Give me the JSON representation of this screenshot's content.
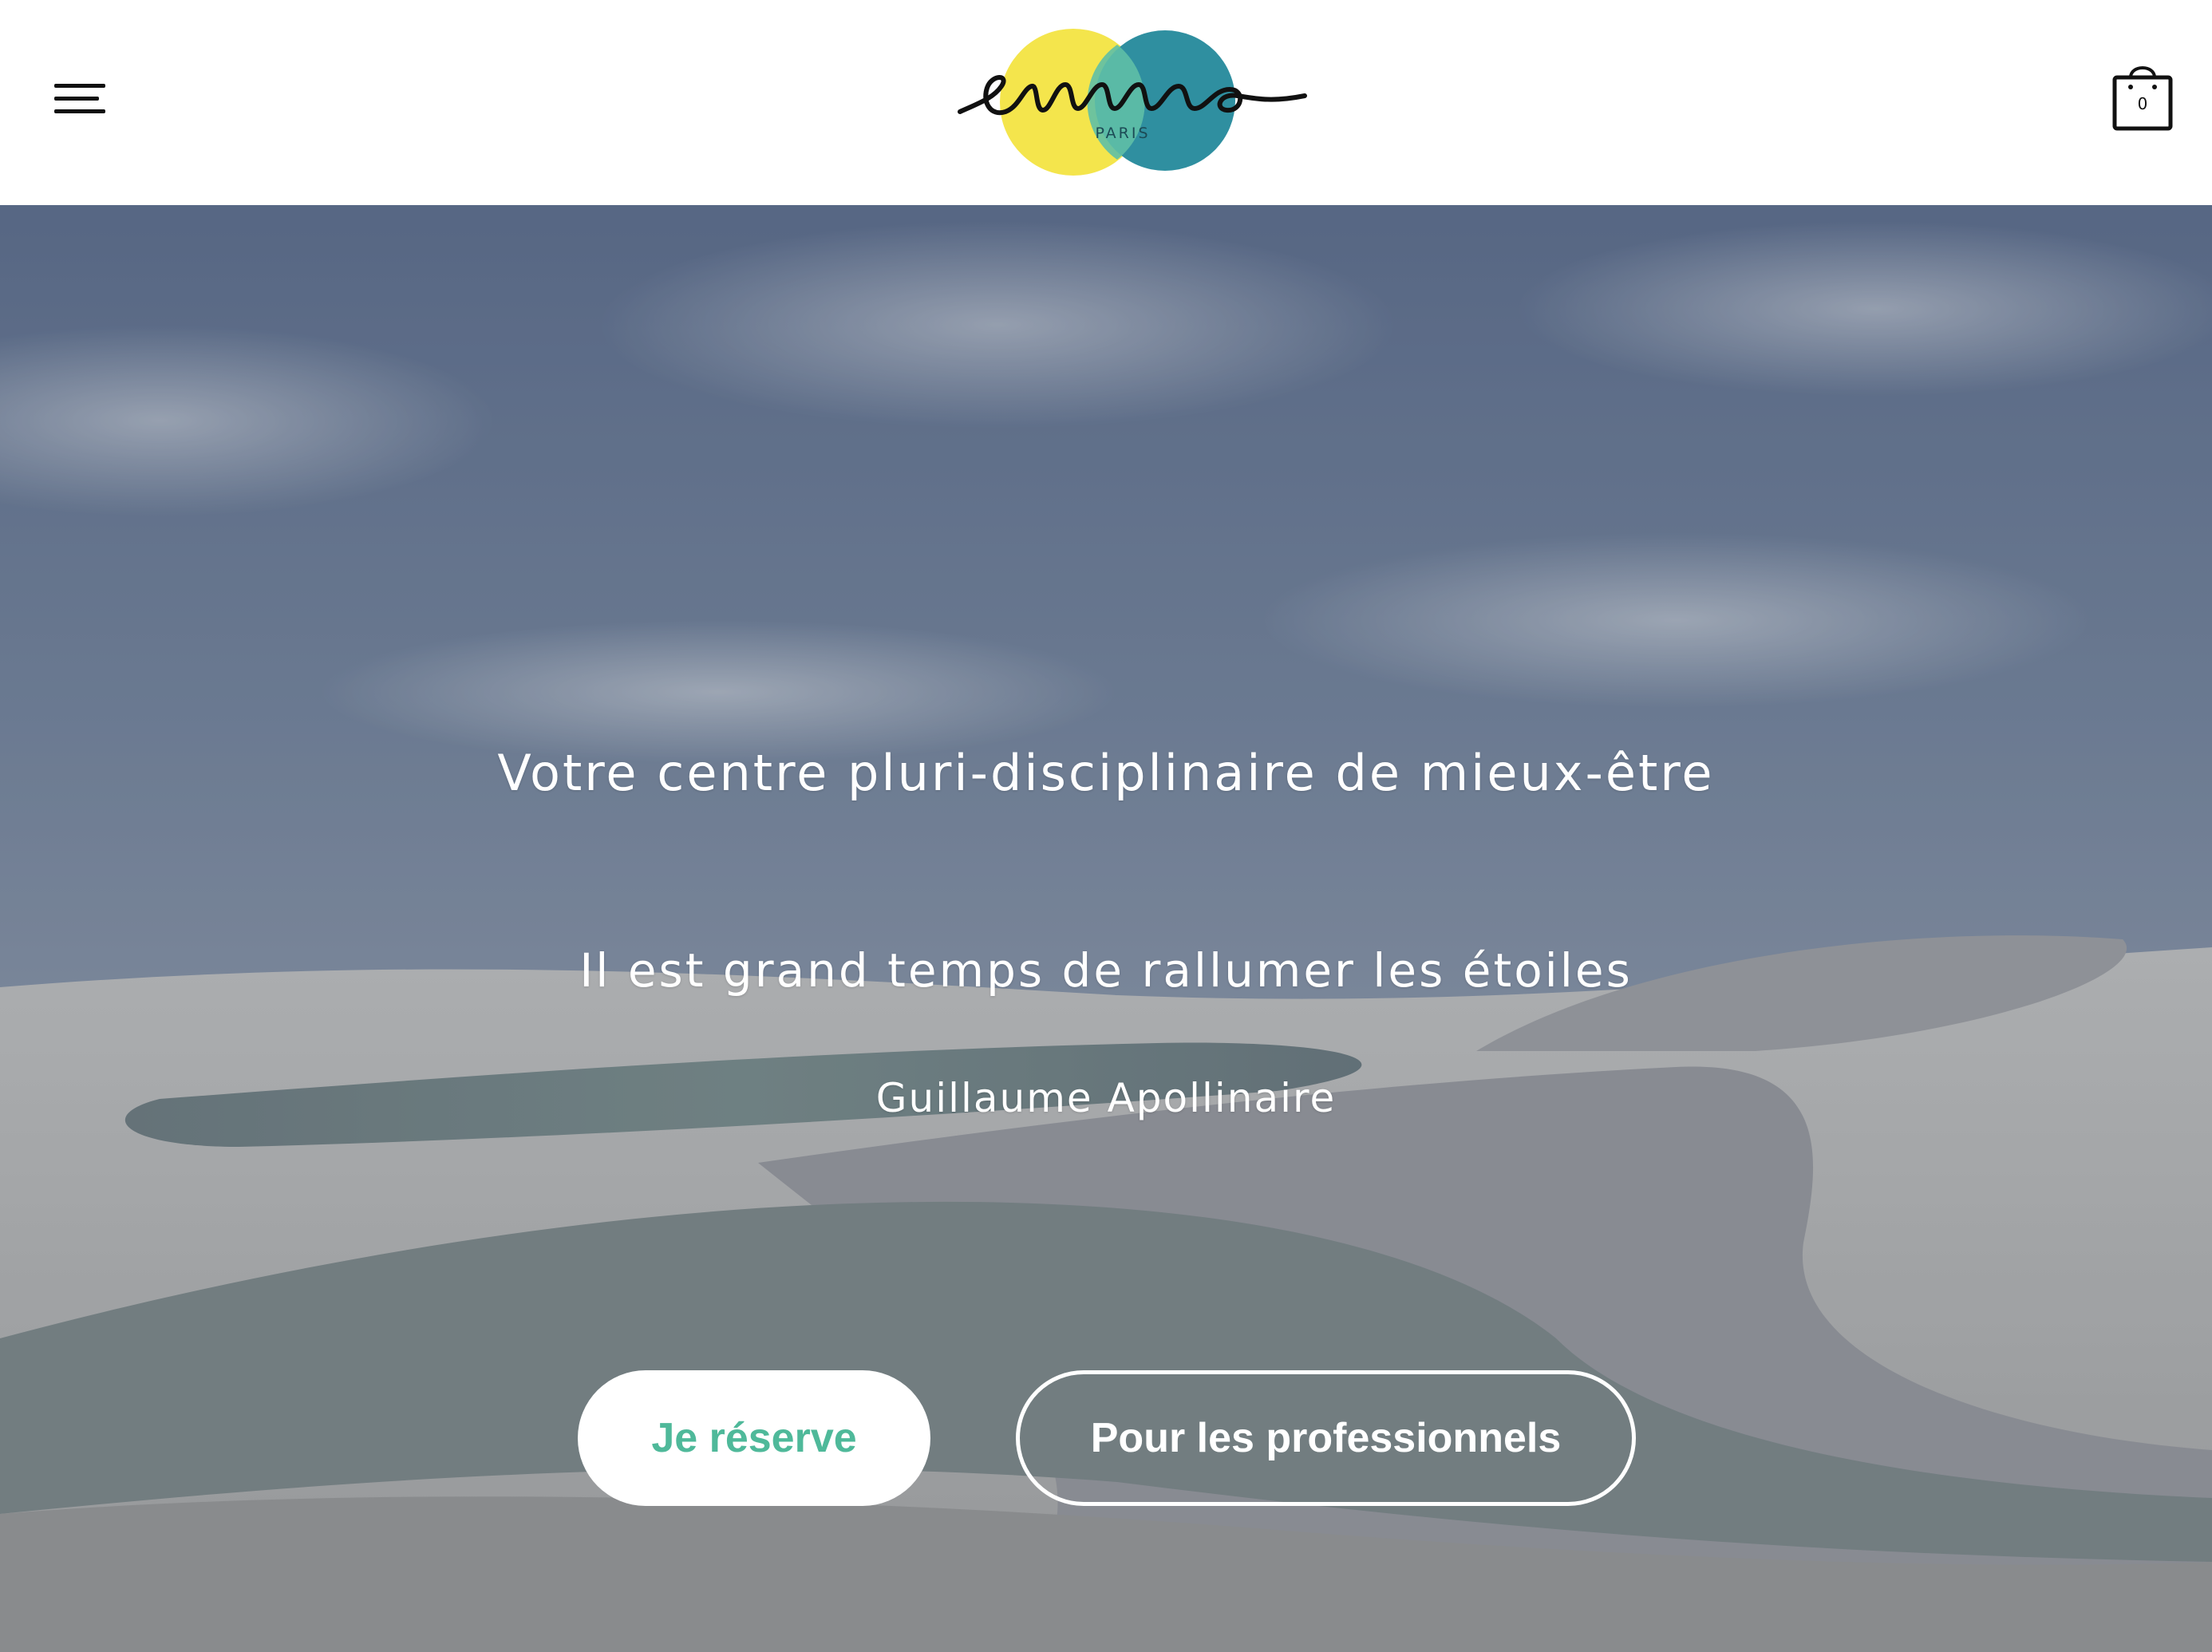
{
  "header": {
    "menu_icon": "hamburger-menu-icon",
    "logo": {
      "wordmark": "emma",
      "sub": "PARIS",
      "colors": {
        "yellow": "#f4e54c",
        "teal": "#2f8fa0",
        "overlap": "#5fbfa6"
      }
    },
    "cart": {
      "icon": "shopping-bag-icon",
      "count": "0"
    }
  },
  "hero": {
    "tagline": "Votre centre pluri-disciplinaire de mieux-être",
    "quote": "Il est grand temps de rallumer les étoiles",
    "author": "Guillaume Apollinaire",
    "buttons": {
      "reserve": "Je réserve",
      "professionals": "Pour les professionnels"
    },
    "accent_color": "#4fb99a"
  }
}
